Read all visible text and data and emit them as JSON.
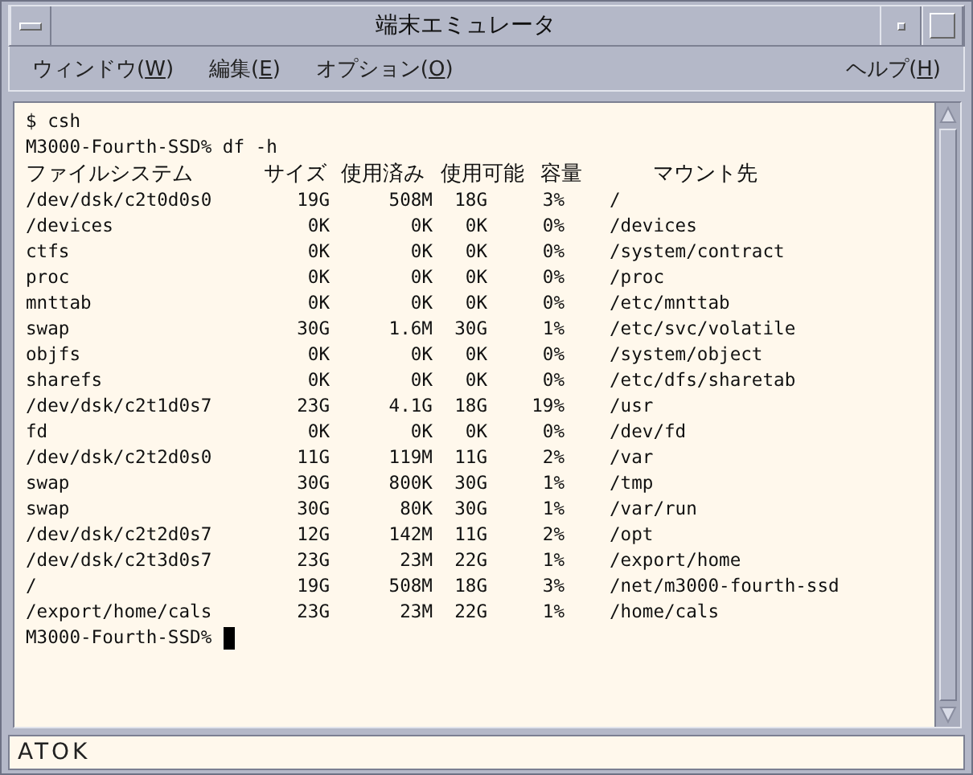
{
  "window": {
    "title": "端末エミュレータ"
  },
  "menu": [
    {
      "label": "ウィンドウ",
      "mnemonic": "(W)"
    },
    {
      "label": "編集",
      "mnemonic": "(E)"
    },
    {
      "label": "オプション",
      "mnemonic": "(O)"
    },
    {
      "label": "ヘルプ",
      "mnemonic": "(H)"
    }
  ],
  "terminal": {
    "lines_before": [
      "$ csh",
      "M3000-Fourth-SSD% df -h"
    ],
    "table": {
      "columns": [
        "ファイルシステム",
        "サイズ",
        "使用済み",
        "使用可能",
        "容量",
        "マウント先"
      ],
      "rows": [
        [
          "/dev/dsk/c2t0d0s0",
          "19G",
          "508M",
          "18G",
          "3%",
          "/"
        ],
        [
          "/devices",
          "0K",
          "0K",
          "0K",
          "0%",
          "/devices"
        ],
        [
          "ctfs",
          "0K",
          "0K",
          "0K",
          "0%",
          "/system/contract"
        ],
        [
          "proc",
          "0K",
          "0K",
          "0K",
          "0%",
          "/proc"
        ],
        [
          "mnttab",
          "0K",
          "0K",
          "0K",
          "0%",
          "/etc/mnttab"
        ],
        [
          "swap",
          "30G",
          "1.6M",
          "30G",
          "1%",
          "/etc/svc/volatile"
        ],
        [
          "objfs",
          "0K",
          "0K",
          "0K",
          "0%",
          "/system/object"
        ],
        [
          "sharefs",
          "0K",
          "0K",
          "0K",
          "0%",
          "/etc/dfs/sharetab"
        ],
        [
          "/dev/dsk/c2t1d0s7",
          "23G",
          "4.1G",
          "18G",
          "19%",
          "/usr"
        ],
        [
          "fd",
          "0K",
          "0K",
          "0K",
          "0%",
          "/dev/fd"
        ],
        [
          "/dev/dsk/c2t2d0s0",
          "11G",
          "119M",
          "11G",
          "2%",
          "/var"
        ],
        [
          "swap",
          "30G",
          "800K",
          "30G",
          "1%",
          "/tmp"
        ],
        [
          "swap",
          "30G",
          "80K",
          "30G",
          "1%",
          "/var/run"
        ],
        [
          "/dev/dsk/c2t2d0s7",
          "12G",
          "142M",
          "11G",
          "2%",
          "/opt"
        ],
        [
          "/dev/dsk/c2t3d0s7",
          "23G",
          "23M",
          "22G",
          "1%",
          "/export/home"
        ],
        [
          "/",
          "19G",
          "508M",
          "18G",
          "3%",
          "/net/m3000-fourth-ssd"
        ],
        [
          "/export/home/cals",
          "23G",
          "23M",
          "22G",
          "1%",
          "/home/cals"
        ]
      ]
    },
    "prompt": "M3000-Fourth-SSD%"
  },
  "input_method": {
    "label": "ATOK"
  }
}
